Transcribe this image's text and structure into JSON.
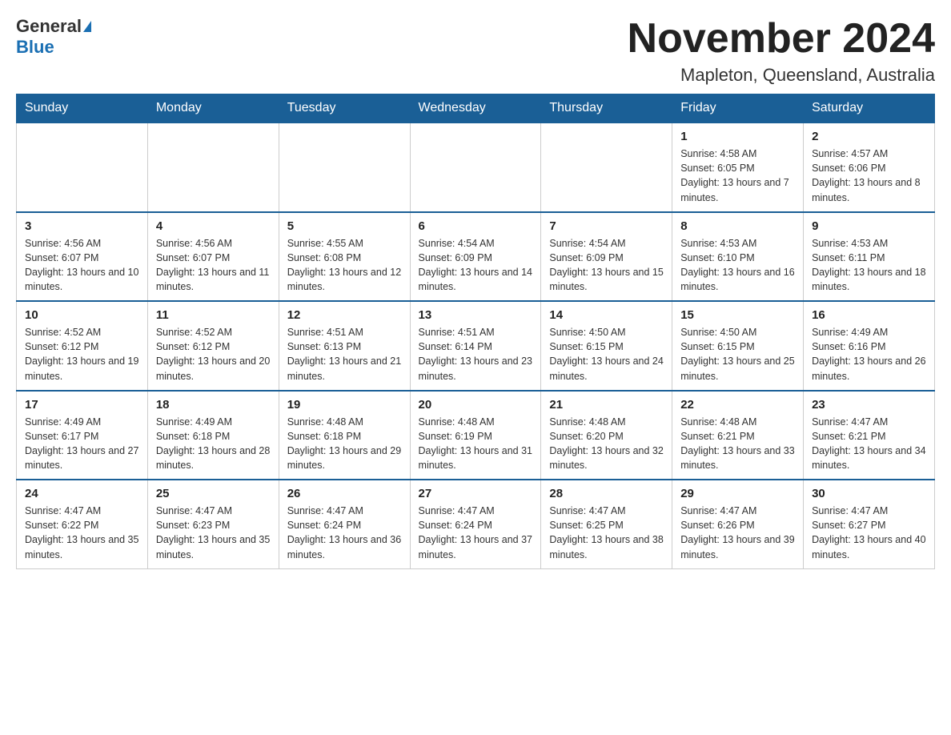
{
  "logo": {
    "general": "General",
    "blue": "Blue"
  },
  "title": "November 2024",
  "location": "Mapleton, Queensland, Australia",
  "days_of_week": [
    "Sunday",
    "Monday",
    "Tuesday",
    "Wednesday",
    "Thursday",
    "Friday",
    "Saturday"
  ],
  "weeks": [
    [
      {
        "day": "",
        "info": ""
      },
      {
        "day": "",
        "info": ""
      },
      {
        "day": "",
        "info": ""
      },
      {
        "day": "",
        "info": ""
      },
      {
        "day": "",
        "info": ""
      },
      {
        "day": "1",
        "info": "Sunrise: 4:58 AM\nSunset: 6:05 PM\nDaylight: 13 hours and 7 minutes."
      },
      {
        "day": "2",
        "info": "Sunrise: 4:57 AM\nSunset: 6:06 PM\nDaylight: 13 hours and 8 minutes."
      }
    ],
    [
      {
        "day": "3",
        "info": "Sunrise: 4:56 AM\nSunset: 6:07 PM\nDaylight: 13 hours and 10 minutes."
      },
      {
        "day": "4",
        "info": "Sunrise: 4:56 AM\nSunset: 6:07 PM\nDaylight: 13 hours and 11 minutes."
      },
      {
        "day": "5",
        "info": "Sunrise: 4:55 AM\nSunset: 6:08 PM\nDaylight: 13 hours and 12 minutes."
      },
      {
        "day": "6",
        "info": "Sunrise: 4:54 AM\nSunset: 6:09 PM\nDaylight: 13 hours and 14 minutes."
      },
      {
        "day": "7",
        "info": "Sunrise: 4:54 AM\nSunset: 6:09 PM\nDaylight: 13 hours and 15 minutes."
      },
      {
        "day": "8",
        "info": "Sunrise: 4:53 AM\nSunset: 6:10 PM\nDaylight: 13 hours and 16 minutes."
      },
      {
        "day": "9",
        "info": "Sunrise: 4:53 AM\nSunset: 6:11 PM\nDaylight: 13 hours and 18 minutes."
      }
    ],
    [
      {
        "day": "10",
        "info": "Sunrise: 4:52 AM\nSunset: 6:12 PM\nDaylight: 13 hours and 19 minutes."
      },
      {
        "day": "11",
        "info": "Sunrise: 4:52 AM\nSunset: 6:12 PM\nDaylight: 13 hours and 20 minutes."
      },
      {
        "day": "12",
        "info": "Sunrise: 4:51 AM\nSunset: 6:13 PM\nDaylight: 13 hours and 21 minutes."
      },
      {
        "day": "13",
        "info": "Sunrise: 4:51 AM\nSunset: 6:14 PM\nDaylight: 13 hours and 23 minutes."
      },
      {
        "day": "14",
        "info": "Sunrise: 4:50 AM\nSunset: 6:15 PM\nDaylight: 13 hours and 24 minutes."
      },
      {
        "day": "15",
        "info": "Sunrise: 4:50 AM\nSunset: 6:15 PM\nDaylight: 13 hours and 25 minutes."
      },
      {
        "day": "16",
        "info": "Sunrise: 4:49 AM\nSunset: 6:16 PM\nDaylight: 13 hours and 26 minutes."
      }
    ],
    [
      {
        "day": "17",
        "info": "Sunrise: 4:49 AM\nSunset: 6:17 PM\nDaylight: 13 hours and 27 minutes."
      },
      {
        "day": "18",
        "info": "Sunrise: 4:49 AM\nSunset: 6:18 PM\nDaylight: 13 hours and 28 minutes."
      },
      {
        "day": "19",
        "info": "Sunrise: 4:48 AM\nSunset: 6:18 PM\nDaylight: 13 hours and 29 minutes."
      },
      {
        "day": "20",
        "info": "Sunrise: 4:48 AM\nSunset: 6:19 PM\nDaylight: 13 hours and 31 minutes."
      },
      {
        "day": "21",
        "info": "Sunrise: 4:48 AM\nSunset: 6:20 PM\nDaylight: 13 hours and 32 minutes."
      },
      {
        "day": "22",
        "info": "Sunrise: 4:48 AM\nSunset: 6:21 PM\nDaylight: 13 hours and 33 minutes."
      },
      {
        "day": "23",
        "info": "Sunrise: 4:47 AM\nSunset: 6:21 PM\nDaylight: 13 hours and 34 minutes."
      }
    ],
    [
      {
        "day": "24",
        "info": "Sunrise: 4:47 AM\nSunset: 6:22 PM\nDaylight: 13 hours and 35 minutes."
      },
      {
        "day": "25",
        "info": "Sunrise: 4:47 AM\nSunset: 6:23 PM\nDaylight: 13 hours and 35 minutes."
      },
      {
        "day": "26",
        "info": "Sunrise: 4:47 AM\nSunset: 6:24 PM\nDaylight: 13 hours and 36 minutes."
      },
      {
        "day": "27",
        "info": "Sunrise: 4:47 AM\nSunset: 6:24 PM\nDaylight: 13 hours and 37 minutes."
      },
      {
        "day": "28",
        "info": "Sunrise: 4:47 AM\nSunset: 6:25 PM\nDaylight: 13 hours and 38 minutes."
      },
      {
        "day": "29",
        "info": "Sunrise: 4:47 AM\nSunset: 6:26 PM\nDaylight: 13 hours and 39 minutes."
      },
      {
        "day": "30",
        "info": "Sunrise: 4:47 AM\nSunset: 6:27 PM\nDaylight: 13 hours and 40 minutes."
      }
    ]
  ]
}
